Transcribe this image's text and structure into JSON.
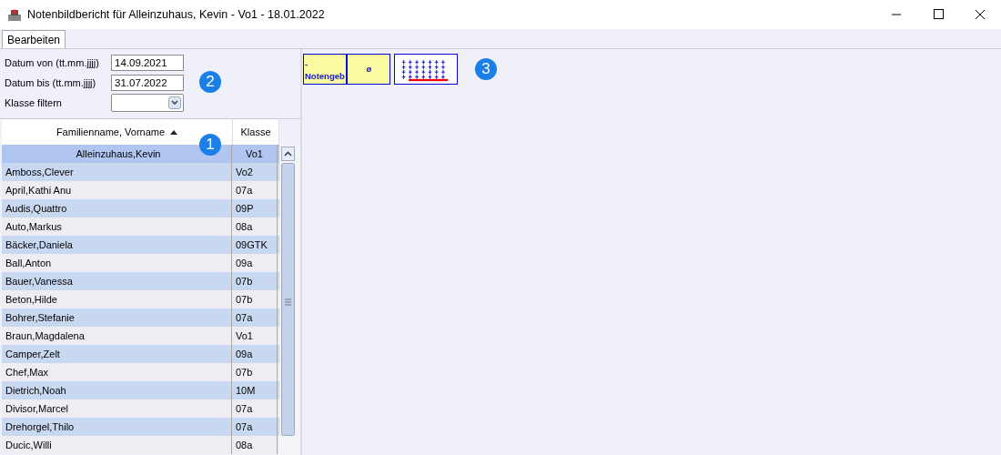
{
  "window": {
    "title": "Notenbildbericht für Alleinzuhaus, Kevin - Vo1 - 18.01.2022"
  },
  "tabs": [
    {
      "label": "Bearbeiten",
      "selected": true
    }
  ],
  "filters": [
    {
      "label": "Datum von (tt.mm.jjjj)",
      "kind": "text",
      "value": "14.09.2021"
    },
    {
      "label": "Datum bis (tt.mm.jjjj)",
      "kind": "text",
      "value": "31.07.2022"
    },
    {
      "label": "Klasse filtern",
      "kind": "dropdown"
    }
  ],
  "table": {
    "columns": [
      {
        "label": "Familienname, Vorname",
        "sorted": true
      },
      {
        "label": "Klasse",
        "sorted": false
      }
    ],
    "rows": [
      {
        "name": "Alleinzuhaus,Kevin",
        "class": "Vo1",
        "selected": true
      },
      {
        "name": "Amboss,Clever",
        "class": "Vo2",
        "selected": false
      },
      {
        "name": "April,Kathi Anu",
        "class": "07a",
        "selected": false
      },
      {
        "name": "Audis,Quattro",
        "class": "09P",
        "selected": false
      },
      {
        "name": "Auto,Markus",
        "class": "08a",
        "selected": false
      },
      {
        "name": "Bäcker,Daniela",
        "class": "09GTK",
        "selected": false
      },
      {
        "name": "Ball,Anton",
        "class": "09a",
        "selected": false
      },
      {
        "name": "Bauer,Vanessa",
        "class": "07b",
        "selected": false
      },
      {
        "name": "Beton,Hilde",
        "class": "07b",
        "selected": false
      },
      {
        "name": "Bohrer,Stefanie",
        "class": "07a",
        "selected": false
      },
      {
        "name": "Braun,Magdalena",
        "class": "Vo1",
        "selected": false
      },
      {
        "name": "Camper,Zelt",
        "class": "09a",
        "selected": false
      },
      {
        "name": "Chef,Max",
        "class": "07b",
        "selected": false
      },
      {
        "name": "Dietrich,Noah",
        "class": "10M",
        "selected": false
      },
      {
        "name": "Divisor,Marcel",
        "class": "07a",
        "selected": false
      },
      {
        "name": "Drehorgel,Thilo",
        "class": "07a",
        "selected": false
      },
      {
        "name": "Ducic,Willi",
        "class": "08a",
        "selected": false
      }
    ]
  },
  "toolbar": [
    {
      "kind": "text",
      "label": "-\nNotengeb"
    },
    {
      "kind": "text",
      "label": "ø"
    },
    {
      "kind": "grid"
    }
  ],
  "callouts": [
    "1",
    "2",
    "3"
  ]
}
